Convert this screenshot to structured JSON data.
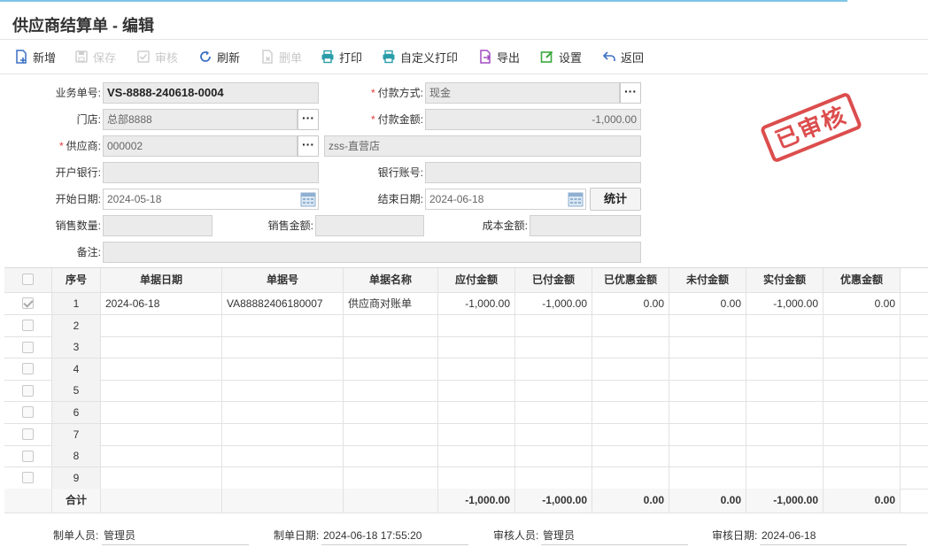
{
  "page": {
    "title": "供应商结算单 - 编辑"
  },
  "toolbar": [
    {
      "key": "add",
      "label": "新增",
      "icon": "new-doc-icon",
      "enabled": true,
      "color": "#3a6fc4"
    },
    {
      "key": "save",
      "label": "保存",
      "icon": "save-icon",
      "enabled": false,
      "color": "#4caf50"
    },
    {
      "key": "audit",
      "label": "审核",
      "icon": "audit-icon",
      "enabled": false,
      "color": "#e07a3a"
    },
    {
      "key": "refresh",
      "label": "刷新",
      "icon": "refresh-icon",
      "enabled": true,
      "color": "#3a6fc4"
    },
    {
      "key": "delete",
      "label": "删单",
      "icon": "delete-doc-icon",
      "enabled": false,
      "color": "#e23a3a"
    },
    {
      "key": "print",
      "label": "打印",
      "icon": "print-icon",
      "enabled": true,
      "color": "#2a9da8"
    },
    {
      "key": "custom_print",
      "label": "自定义打印",
      "icon": "print-icon",
      "enabled": true,
      "color": "#2a9da8"
    },
    {
      "key": "export",
      "label": "导出",
      "icon": "export-icon",
      "enabled": true,
      "color": "#a24cc4"
    },
    {
      "key": "settings",
      "label": "设置",
      "icon": "edit-settings-icon",
      "enabled": true,
      "color": "#3aa83a"
    },
    {
      "key": "back",
      "label": "返回",
      "icon": "back-arrow-icon",
      "enabled": true,
      "color": "#3a6fc4"
    }
  ],
  "form": {
    "doc_no_label": "业务单号:",
    "doc_no": "VS-8888-240618-0004",
    "payment_method_label": "付款方式:",
    "payment_method": "现金",
    "store_label": "门店:",
    "store": "总部8888",
    "payment_amount_label": "付款金额:",
    "payment_amount": "-1,000.00",
    "supplier_label": "供应商:",
    "supplier_code": "000002",
    "supplier_name": "zss-直营店",
    "bank_label": "开户银行:",
    "bank": "",
    "account_label": "银行账号:",
    "account": "",
    "start_date_label": "开始日期:",
    "start_date": "2024-05-18",
    "end_date_label": "结束日期:",
    "end_date": "2024-06-18",
    "stat_button": "统计",
    "sales_qty_label": "销售数量:",
    "sales_qty": "",
    "sales_amount_label": "销售金额:",
    "sales_amount": "",
    "cost_amount_label": "成本金额:",
    "cost_amount": "",
    "remark_label": "备注:",
    "remark": "",
    "more_glyph": "···",
    "required_mark": "*"
  },
  "stamp": {
    "text": "已审核",
    "color": "#d93a3a"
  },
  "grid": {
    "headers": [
      "序号",
      "单据日期",
      "单据号",
      "单据名称",
      "应付金额",
      "已付金额",
      "已优惠金额",
      "未付金额",
      "实付金额",
      "优惠金额"
    ],
    "rows": [
      {
        "no": "1",
        "checked": true,
        "date": "2024-06-18",
        "doc_no": "VA88882406180007",
        "doc_name": "供应商对账单",
        "payable": "-1,000.00",
        "paid": "-1,000.00",
        "discounted": "0.00",
        "unpaid": "0.00",
        "actual": "-1,000.00",
        "discount": "0.00"
      },
      {
        "no": "2",
        "checked": false,
        "date": "",
        "doc_no": "",
        "doc_name": "",
        "payable": "",
        "paid": "",
        "discounted": "",
        "unpaid": "",
        "actual": "",
        "discount": ""
      },
      {
        "no": "3",
        "checked": false,
        "date": "",
        "doc_no": "",
        "doc_name": "",
        "payable": "",
        "paid": "",
        "discounted": "",
        "unpaid": "",
        "actual": "",
        "discount": ""
      },
      {
        "no": "4",
        "checked": false,
        "date": "",
        "doc_no": "",
        "doc_name": "",
        "payable": "",
        "paid": "",
        "discounted": "",
        "unpaid": "",
        "actual": "",
        "discount": ""
      },
      {
        "no": "5",
        "checked": false,
        "date": "",
        "doc_no": "",
        "doc_name": "",
        "payable": "",
        "paid": "",
        "discounted": "",
        "unpaid": "",
        "actual": "",
        "discount": ""
      },
      {
        "no": "6",
        "checked": false,
        "date": "",
        "doc_no": "",
        "doc_name": "",
        "payable": "",
        "paid": "",
        "discounted": "",
        "unpaid": "",
        "actual": "",
        "discount": ""
      },
      {
        "no": "7",
        "checked": false,
        "date": "",
        "doc_no": "",
        "doc_name": "",
        "payable": "",
        "paid": "",
        "discounted": "",
        "unpaid": "",
        "actual": "",
        "discount": ""
      },
      {
        "no": "8",
        "checked": false,
        "date": "",
        "doc_no": "",
        "doc_name": "",
        "payable": "",
        "paid": "",
        "discounted": "",
        "unpaid": "",
        "actual": "",
        "discount": ""
      },
      {
        "no": "9",
        "checked": false,
        "date": "",
        "doc_no": "",
        "doc_name": "",
        "payable": "",
        "paid": "",
        "discounted": "",
        "unpaid": "",
        "actual": "",
        "discount": ""
      }
    ],
    "total": {
      "label": "合计",
      "payable": "-1,000.00",
      "paid": "-1,000.00",
      "discounted": "0.00",
      "unpaid": "0.00",
      "actual": "-1,000.00",
      "discount": "0.00"
    }
  },
  "footer": {
    "creator_label": "制单人员:",
    "creator": "管理员",
    "created_label": "制单日期:",
    "created": "2024-06-18 17:55:20",
    "auditor_label": "审核人员:",
    "auditor": "管理员",
    "audited_label": "审核日期:",
    "audited": "2024-06-18"
  }
}
